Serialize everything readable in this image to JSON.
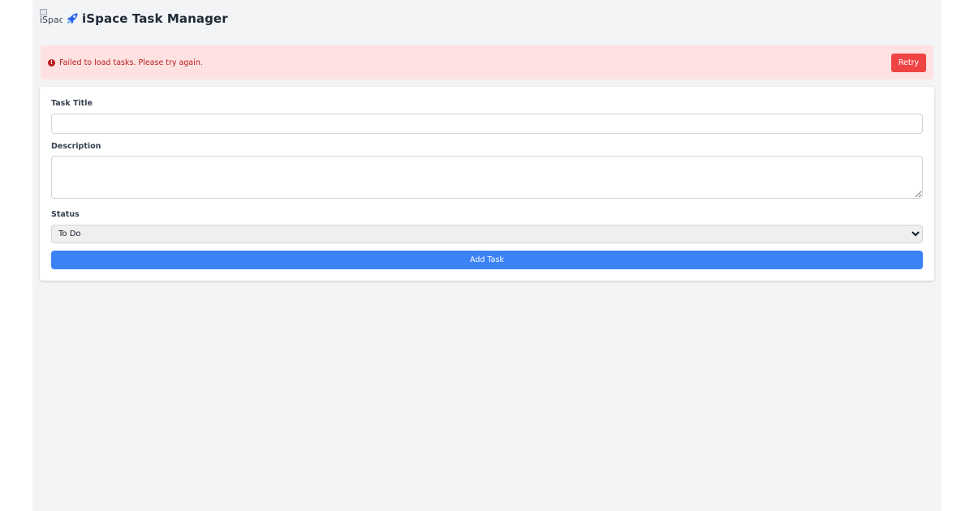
{
  "header": {
    "logo_alt": "iSpace",
    "title": "iSpace Task Manager"
  },
  "alert": {
    "message": "Failed to load tasks. Please try again.",
    "icon": "exclamation-circle-icon",
    "retry_label": "Retry"
  },
  "form": {
    "title_label": "Task Title",
    "title_value": "",
    "description_label": "Description",
    "description_value": "",
    "status_label": "Status",
    "status_selected": "To Do",
    "submit_label": "Add Task"
  },
  "colors": {
    "page_bg": "#f3f4f6",
    "alert_bg": "#fee2e2",
    "alert_text": "#b91c1c",
    "retry_bg": "#ef4444",
    "primary": "#3b82f6"
  }
}
